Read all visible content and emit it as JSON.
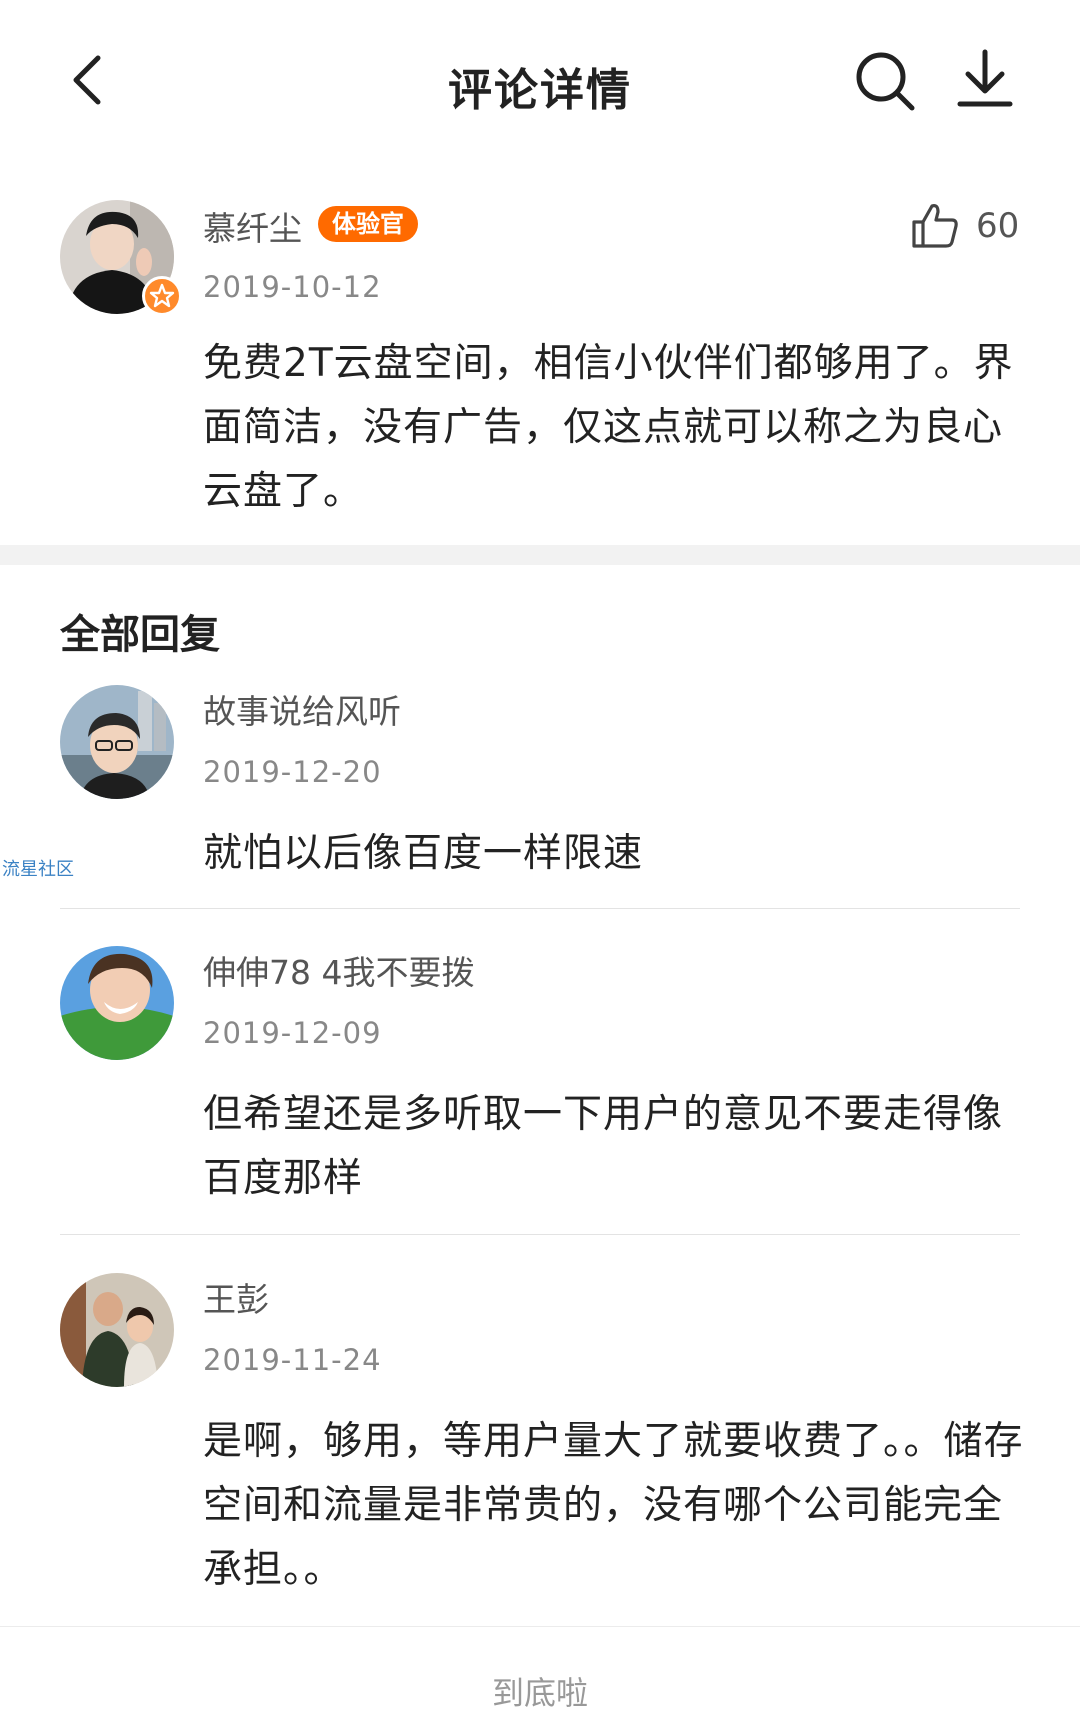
{
  "header": {
    "title": "评论详情",
    "back_icon": "chevron-left-icon",
    "search_icon": "search-icon",
    "download_icon": "download-icon"
  },
  "main_comment": {
    "username": "慕纤尘",
    "role_badge": "体验官",
    "date": "2019-10-12",
    "like_count": "60",
    "text": "免费2T云盘空间，相信小伙伴们都够用了。界面简洁，没有广告，仅这点就可以称之为良心云盘了。",
    "badge_color": "#ff6a00"
  },
  "replies_section": {
    "title": "全部回复"
  },
  "watermark": "流星社区",
  "replies": [
    {
      "username": "故事说给风听",
      "date": "2019-12-20",
      "text": "就怕以后像百度一样限速"
    },
    {
      "username": "伸伸78 4我不要拨",
      "date": "2019-12-09",
      "text": "但希望还是多听取一下用户的意见不要走得像百度那样"
    },
    {
      "username": "王彭",
      "date": "2019-11-24",
      "text": "是啊，够用，等用户量大了就要收费了。。储存空间和流量是非常贵的，没有哪个公司能完全承担。。"
    }
  ],
  "footer": {
    "end_text": "到底啦"
  }
}
